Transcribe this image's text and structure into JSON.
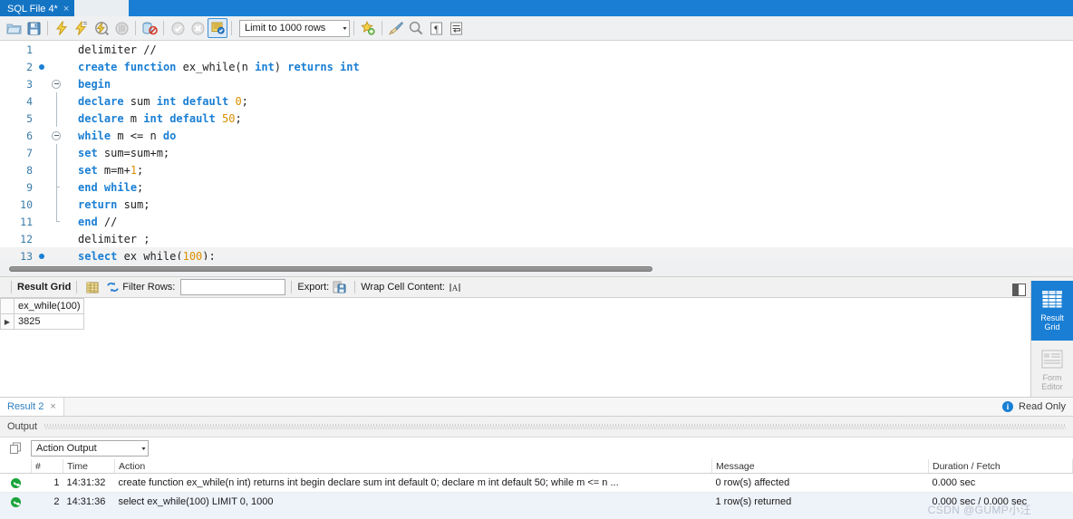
{
  "window": {
    "tab": {
      "title": "SQL File 4*",
      "close": "×"
    }
  },
  "toolbar": {
    "icons": [
      {
        "name": "open-file-icon",
        "title": "Open SQL Script"
      },
      {
        "name": "save-file-icon",
        "title": "Save SQL Script"
      },
      {
        "name": "execute-icon",
        "title": "Execute"
      },
      {
        "name": "execute-current-icon",
        "title": "Execute Current Statement"
      },
      {
        "name": "explain-icon",
        "title": "Explain"
      },
      {
        "name": "stop-icon",
        "title": "Stop"
      },
      {
        "name": "toggle-schema-icon",
        "title": "Toggle Schema"
      },
      {
        "name": "commit-icon",
        "title": "Commit"
      },
      {
        "name": "rollback-icon",
        "title": "Rollback"
      },
      {
        "name": "autocommit-icon",
        "title": "Toggle Autocommit"
      },
      {
        "name": "beautify-icon",
        "title": "Beautify SQL"
      },
      {
        "name": "find-icon",
        "title": "Find"
      },
      {
        "name": "invisible-chars-icon",
        "title": "Toggle Invisible Characters"
      },
      {
        "name": "wrap-lines-icon",
        "title": "Toggle Wrapping"
      }
    ],
    "limit_select": {
      "value": "Limit to 1000 rows",
      "caret": "▾"
    }
  },
  "editor": {
    "lines": [
      {
        "n": "1",
        "breakpoint": false,
        "fold": "none",
        "current": false,
        "tokens": [
          {
            "t": "plain",
            "v": "delimiter //"
          }
        ]
      },
      {
        "n": "2",
        "breakpoint": true,
        "fold": "none",
        "current": false,
        "tokens": [
          {
            "t": "kw",
            "v": "create"
          },
          {
            "t": "plain",
            "v": " "
          },
          {
            "t": "kw",
            "v": "function"
          },
          {
            "t": "plain",
            "v": " ex_while(n "
          },
          {
            "t": "kw",
            "v": "int"
          },
          {
            "t": "plain",
            "v": ") "
          },
          {
            "t": "kw",
            "v": "returns"
          },
          {
            "t": "plain",
            "v": " "
          },
          {
            "t": "kw",
            "v": "int"
          }
        ]
      },
      {
        "n": "3",
        "breakpoint": false,
        "fold": "open",
        "current": false,
        "tokens": [
          {
            "t": "kw",
            "v": "begin"
          }
        ]
      },
      {
        "n": "4",
        "breakpoint": false,
        "fold": "line",
        "current": false,
        "tokens": [
          {
            "t": "kw",
            "v": "declare"
          },
          {
            "t": "plain",
            "v": " sum "
          },
          {
            "t": "kw",
            "v": "int"
          },
          {
            "t": "plain",
            "v": " "
          },
          {
            "t": "kw",
            "v": "default"
          },
          {
            "t": "plain",
            "v": " "
          },
          {
            "t": "num",
            "v": "0"
          },
          {
            "t": "plain",
            "v": ";"
          }
        ]
      },
      {
        "n": "5",
        "breakpoint": false,
        "fold": "line",
        "current": false,
        "tokens": [
          {
            "t": "kw",
            "v": "declare"
          },
          {
            "t": "plain",
            "v": " m "
          },
          {
            "t": "kw",
            "v": "int"
          },
          {
            "t": "plain",
            "v": " "
          },
          {
            "t": "kw",
            "v": "default"
          },
          {
            "t": "plain",
            "v": " "
          },
          {
            "t": "num",
            "v": "50"
          },
          {
            "t": "plain",
            "v": ";"
          }
        ]
      },
      {
        "n": "6",
        "breakpoint": false,
        "fold": "open2",
        "current": false,
        "tokens": [
          {
            "t": "kw",
            "v": "while"
          },
          {
            "t": "plain",
            "v": " m <= n "
          },
          {
            "t": "kw",
            "v": "do"
          }
        ]
      },
      {
        "n": "7",
        "breakpoint": false,
        "fold": "line",
        "current": false,
        "tokens": [
          {
            "t": "kw",
            "v": "set"
          },
          {
            "t": "plain",
            "v": " sum=sum+m;"
          }
        ]
      },
      {
        "n": "8",
        "breakpoint": false,
        "fold": "line",
        "current": false,
        "tokens": [
          {
            "t": "kw",
            "v": "set"
          },
          {
            "t": "plain",
            "v": " m=m+"
          },
          {
            "t": "num",
            "v": "1"
          },
          {
            "t": "plain",
            "v": ";"
          }
        ]
      },
      {
        "n": "9",
        "breakpoint": false,
        "fold": "tick",
        "current": false,
        "tokens": [
          {
            "t": "kw",
            "v": "end"
          },
          {
            "t": "plain",
            "v": " "
          },
          {
            "t": "kw",
            "v": "while"
          },
          {
            "t": "plain",
            "v": ";"
          }
        ]
      },
      {
        "n": "10",
        "breakpoint": false,
        "fold": "line",
        "current": false,
        "tokens": [
          {
            "t": "kw",
            "v": "return"
          },
          {
            "t": "plain",
            "v": " sum;"
          }
        ]
      },
      {
        "n": "11",
        "breakpoint": false,
        "fold": "end",
        "current": false,
        "tokens": [
          {
            "t": "kw",
            "v": "end"
          },
          {
            "t": "plain",
            "v": " //"
          }
        ]
      },
      {
        "n": "12",
        "breakpoint": false,
        "fold": "none",
        "current": false,
        "tokens": [
          {
            "t": "plain",
            "v": "delimiter ;"
          }
        ]
      },
      {
        "n": "13",
        "breakpoint": true,
        "fold": "none",
        "current": true,
        "tokens": [
          {
            "t": "kw",
            "v": "select"
          },
          {
            "t": "plain",
            "v": " ex_while("
          },
          {
            "t": "num",
            "v": "100"
          },
          {
            "t": "plain",
            "v": ");"
          }
        ]
      }
    ]
  },
  "result_toolbar": {
    "result_grid_label": "Result Grid",
    "grid_icon": "grid-icon",
    "refresh_icon": "refresh-icon",
    "filter_label": "Filter Rows:",
    "filter_value": "",
    "filter_placeholder": "",
    "export_label": "Export:",
    "export_icon": "export-icon",
    "wrap_label": "Wrap Cell Content:",
    "wrap_icon": "wrap-cell-icon"
  },
  "result_grid": {
    "columns": [
      "ex_while(100)"
    ],
    "rows": [
      {
        "marker": "▶",
        "cells": [
          "3825"
        ]
      }
    ]
  },
  "side_panel": {
    "buttons": [
      {
        "label_line1": "Result",
        "label_line2": "Grid",
        "icon": "result-grid-icon",
        "active": true
      },
      {
        "label_line1": "Form",
        "label_line2": "Editor",
        "icon": "form-editor-icon",
        "active": false
      }
    ]
  },
  "result_tabs": {
    "tabs": [
      {
        "label": "Result 2",
        "close": "×"
      }
    ],
    "read_only": "Read Only",
    "info_icon": "info-icon"
  },
  "output": {
    "section_label": "Output",
    "selector": {
      "value": "Action Output",
      "caret": "▾",
      "icon": "copy-icon"
    },
    "columns": [
      "",
      "#",
      "Time",
      "Action",
      "Message",
      "Duration / Fetch"
    ],
    "rows": [
      {
        "status": "success",
        "num": "1",
        "time": "14:31:32",
        "action": "create function ex_while(n int) returns int begin declare sum int default 0; declare m int default 50; while m <= n ...",
        "message": "0 row(s) affected",
        "duration": "0.000 sec"
      },
      {
        "status": "success",
        "num": "2",
        "time": "14:31:36",
        "action": "select ex_while(100) LIMIT 0, 1000",
        "message": "1 row(s) returned",
        "duration": "0.000 sec / 0.000 sec"
      }
    ]
  },
  "watermark": {
    "text": "CSDN @GUMP小汪"
  },
  "colors": {
    "accent": "#1a7fd4",
    "keyword": "#1a7fd4",
    "number": "#d98f00",
    "success": "#1aa33a",
    "gutter_text": "#3a7ca8",
    "toolbar_bg": "#eff0f1"
  }
}
